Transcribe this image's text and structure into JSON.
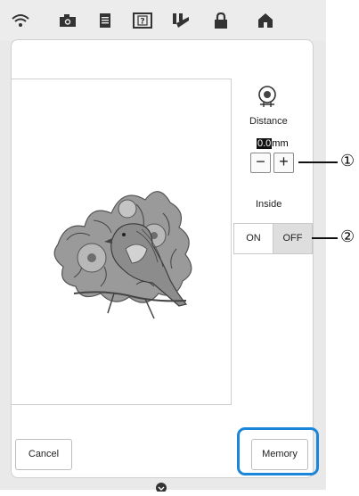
{
  "status_icons": [
    "wifi-icon",
    "camera-icon",
    "document-icon",
    "help-icon",
    "sewing-settings-icon",
    "lock-icon",
    "home-icon"
  ],
  "distance": {
    "label": "Distance",
    "value": "0.0",
    "unit": "mm"
  },
  "stepper": {
    "minus": "−",
    "plus": "+"
  },
  "inside": {
    "label": "Inside",
    "on": "ON",
    "off": "OFF",
    "selected": "OFF"
  },
  "buttons": {
    "cancel": "Cancel",
    "memory": "Memory"
  },
  "callouts": [
    "①",
    "②"
  ],
  "colors": {
    "highlight": "#1a86d9",
    "off_selected_bg": "#dedede"
  }
}
